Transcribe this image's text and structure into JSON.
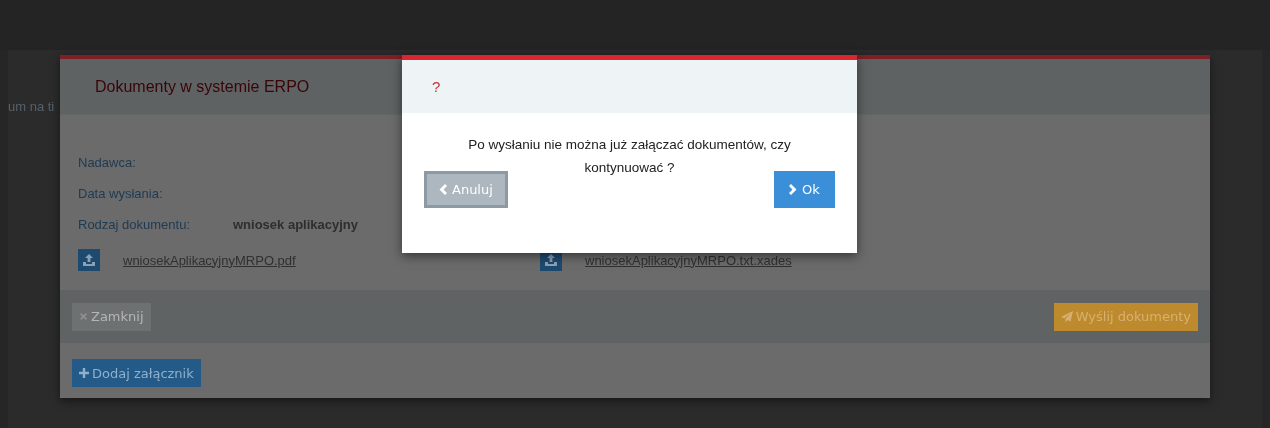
{
  "background_page": {
    "text": "um na ti"
  },
  "documents_modal": {
    "title": "Dokumenty w systemie ERPO",
    "fields": [
      {
        "label": "Nadawca:"
      },
      {
        "label": "Data wysłania:"
      },
      {
        "label": "Rodzaj dokumentu:",
        "value": "wniosek aplikacyjny"
      }
    ],
    "files": [
      "wniosekAplikacyjnyMRPO.pdf",
      "wniosekAplikacyjnyMRPO.txt.xades"
    ],
    "footer_buttons": [
      {
        "label": "Zamknij",
        "kind": "close"
      },
      {
        "label": "Wyślij dokumenty",
        "kind": "send"
      }
    ],
    "add_button": {
      "label": "Dodaj załącznik"
    }
  },
  "confirm_dialog": {
    "title": "?",
    "message": "Po wysłaniu nie można już załączać dokumentów, czy kontynuować ?",
    "buttons": [
      {
        "label": "Anuluj",
        "kind": "cancel"
      },
      {
        "label": "Ok",
        "kind": "ok"
      }
    ]
  }
}
